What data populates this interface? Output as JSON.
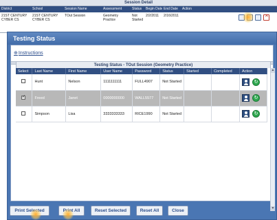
{
  "session": {
    "title": "Session Detail",
    "columns": [
      "District",
      "School",
      "Session Name",
      "Assessment",
      "Status",
      "Begin Date",
      "End Date",
      "Action"
    ],
    "row": {
      "district": "21ST CENTURY CYBER CS",
      "school": "21ST CENTURY CYBER CS",
      "session_name": "TOut Session",
      "assessment": "Geometry Practice",
      "status": "Not Started",
      "begin_date": "2/2/2011",
      "end_date": "2/16/2011"
    }
  },
  "window": {
    "title": "Testing Status",
    "instructions_label": "Instructions",
    "grid_title": "Testing Status - TOut Session (Geometry Practice)",
    "columns": [
      "Select",
      "Last Name",
      "First Name",
      "User Name",
      "Password",
      "Status",
      "Started",
      "Completed",
      "Action"
    ],
    "rows": [
      {
        "last": "Hunt",
        "first": "Nelson",
        "user": "1111111111",
        "password": "FULL4907",
        "status": "Not Started",
        "started": "",
        "completed": "",
        "selected": false
      },
      {
        "last": "Freed",
        "first": "Janet",
        "user": "0000000000",
        "password": "WALL5577",
        "status": "Not Started",
        "started": "",
        "completed": "",
        "selected": true
      },
      {
        "last": "Simpson",
        "first": "Lisa",
        "user": "3333333333",
        "password": "RICE1990",
        "status": "Not Started",
        "started": "",
        "completed": "",
        "selected": false
      }
    ]
  },
  "buttons": {
    "print_selected": "Print Selected",
    "print_all": "Print All",
    "reset_selected": "Reset Selected",
    "reset_all": "Reset All",
    "close": "Close"
  },
  "icons": {
    "person": "person-icon",
    "go": "go-arrow-icon",
    "delete": "delete-icon"
  }
}
